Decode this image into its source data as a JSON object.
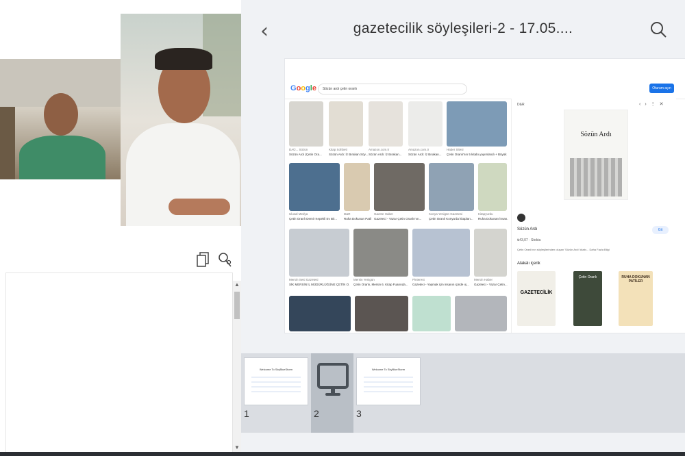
{
  "viewer": {
    "back_label": "‹",
    "title": "gazetecilik söyleşileri-2 - 17.05....",
    "search_icon": "search-icon"
  },
  "browser": {
    "google_logo": "Google",
    "search_query": "Sözün ardı çetin oranlı",
    "signin_label": "Oturum açın",
    "results": [
      {
        "source": "DAÜ... Sözün",
        "caption": "Sözün Ardı (Çetin Ora..."
      },
      {
        "source": "Kitap Sohbeti",
        "caption": "Sözün Ardı: İz Bırakan Söy..."
      },
      {
        "source": "Amazon.com.tr",
        "caption": "Sözün Ardı: İz Bırakan..."
      },
      {
        "source": "Amazon.com.tr",
        "caption": "Sözün Ardı: İz Bırakan..."
      },
      {
        "source": "Haber Sitesi",
        "caption": "Çetin Oranlı'nın 5 kitabı yayımlandı + Böyük..."
      },
      {
        "source": "Ulusal Medya",
        "caption": "Çetin Oranlı Demir Kepekli Ev Bir..."
      },
      {
        "source": "D&R",
        "caption": "Ruha Dokunan Patil..."
      },
      {
        "source": "Gazete Haber",
        "caption": "Gazeteci - Yazar Çetin Oranlı'nın..."
      },
      {
        "source": "Konya Yenigün Gazetesi",
        "caption": "Çetin Oranlı Konya'da kitapları..."
      },
      {
        "source": "Kitapyurdu",
        "caption": "Ruha Dokunan İnsan..."
      },
      {
        "source": "Mersin Sesi Gazetesi",
        "caption": "SİK MERSİN İL MÜDÜRLÜĞÜNE ÇETİN O..."
      },
      {
        "source": "Mersin Yenigün",
        "caption": "Çetin Oranlı, Mersin 6. Kitap Fuarında..."
      },
      {
        "source": "Pinterest",
        "caption": "Gazeteci - Yaşmak için insanın içinde ış..."
      },
      {
        "source": "Mersin Haber",
        "caption": "Gazeteci - Yazar Çetin..."
      }
    ],
    "panel": {
      "site": "D&R",
      "title": "Sözün Ardı",
      "visit_label": "Git",
      "price": "₺43,07 · Stokta",
      "description": "Çetin Oranlı'nın söyleşilerinden oluşan 'Sözün Ardı' kitabı... Daha Fazla Bilgi",
      "related_label": "Alakalı içerik",
      "related_books": [
        "GAZETECİLİK",
        "Çetin Oranlı",
        "RUHA DOKUNAN PATİLER"
      ]
    }
  },
  "slides": [
    {
      "number": "1",
      "title": "Welcome To SkyBlueStorm"
    },
    {
      "number": "2"
    },
    {
      "number": "3",
      "title": "Welcome To SkyBlueStorm"
    }
  ],
  "colors": {
    "accent": "#1a73e8",
    "strip": "#dadde2",
    "selected": "#b9bfc6"
  }
}
